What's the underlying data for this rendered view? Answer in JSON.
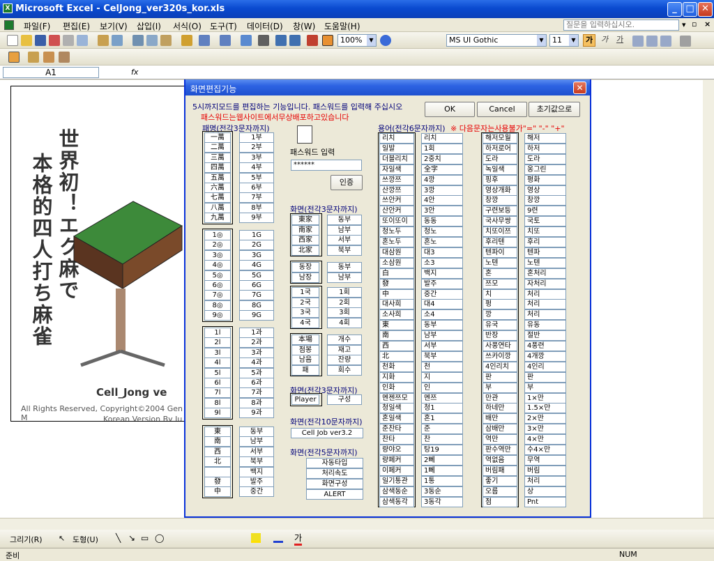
{
  "window": {
    "title": "Microsoft Excel - CelJong_ver320s_kor.xls",
    "minimize": "_",
    "maximize": "□",
    "close": "✕"
  },
  "menus": [
    "파일(F)",
    "편집(E)",
    "보기(V)",
    "삽입(I)",
    "서식(O)",
    "도구(T)",
    "데이터(D)",
    "창(W)",
    "도움말(H)"
  ],
  "help_placeholder": "질문을 입력하십시오.",
  "toolbar": {
    "zoom": "100%",
    "font": "MS UI Gothic",
    "size": "11",
    "bold": "가",
    "italic": "가",
    "underline": "가"
  },
  "formula": {
    "cell": "A1",
    "fx": "fx"
  },
  "splash": {
    "jp": [
      "世界初！エク麻で",
      "本格的四人打ち麻雀"
    ],
    "name": "Cell_Jong ve",
    "copyright": "All Rights Reserved, Copyright©2004 Gen M",
    "korean": "Korean Version By Ju"
  },
  "dialog": {
    "title": "화면편집기능",
    "desc1": "5시까지모드를 편집하는 기능입니다. 패스워드를 입력해 주십시오",
    "desc2": "패스워드는웹사이트에서무상배포하고있습니다",
    "ok": "OK",
    "cancel": "Cancel",
    "reset": "초기값으로",
    "pai_label": "패명(전각3문자까지)",
    "pai": [
      [
        [
          "一萬",
          "1부"
        ],
        [
          "二萬",
          "2부"
        ],
        [
          "三萬",
          "3부"
        ],
        [
          "四萬",
          "4부"
        ],
        [
          "五萬",
          "5부"
        ],
        [
          "六萬",
          "6부"
        ],
        [
          "七萬",
          "7부"
        ],
        [
          "八萬",
          "8부"
        ],
        [
          "九萬",
          "9부"
        ]
      ],
      [
        [
          "1◎",
          "1G"
        ],
        [
          "2◎",
          "2G"
        ],
        [
          "3◎",
          "3G"
        ],
        [
          "4◎",
          "4G"
        ],
        [
          "5◎",
          "5G"
        ],
        [
          "6◎",
          "6G"
        ],
        [
          "7◎",
          "7G"
        ],
        [
          "8◎",
          "8G"
        ],
        [
          "9◎",
          "9G"
        ]
      ],
      [
        [
          "1l",
          "1과"
        ],
        [
          "2l",
          "2과"
        ],
        [
          "3l",
          "3과"
        ],
        [
          "4l",
          "4과"
        ],
        [
          "5l",
          "5과"
        ],
        [
          "6l",
          "6과"
        ],
        [
          "7l",
          "7과"
        ],
        [
          "8l",
          "8과"
        ],
        [
          "9l",
          "9과"
        ]
      ],
      [
        [
          "東",
          "동부"
        ],
        [
          "南",
          "남부"
        ],
        [
          "西",
          "서부"
        ],
        [
          "北",
          "북부"
        ],
        [
          "",
          "백지"
        ],
        [
          "發",
          "발주"
        ],
        [
          "中",
          "중간"
        ]
      ]
    ],
    "pw_label": "패스워드 입력",
    "pw_value": "******",
    "auth": "인증",
    "screen_label": "화면(전각3문자까지)",
    "screen1": [
      [
        "東家",
        "동부"
      ],
      [
        "南家",
        "남부"
      ],
      [
        "西家",
        "서부"
      ],
      [
        "北家",
        "북부"
      ]
    ],
    "screen2": [
      [
        "동장",
        "동부"
      ],
      [
        "남장",
        "남부"
      ]
    ],
    "screen3": [
      [
        "1국",
        "1회"
      ],
      [
        "2국",
        "2회"
      ],
      [
        "3국",
        "3회"
      ],
      [
        "4국",
        "4회"
      ]
    ],
    "screen4": [
      [
        "本場",
        "개수"
      ],
      [
        "점봉",
        "재고"
      ],
      [
        "남음",
        "잔량"
      ],
      [
        "패",
        "회수"
      ]
    ],
    "screen5": [
      [
        "Player",
        "구성"
      ]
    ],
    "screen10_label": "화면(전각10문자까지)",
    "screen10_value": "Cell Job ver3.2",
    "screen5c_label": "화면(전각5문자까지)",
    "screen5c": [
      "자동타입",
      "처리속도",
      "화면구성",
      "ALERT"
    ],
    "yaku_label": "용어(전각6문자까지)",
    "yaku_warn": "※ 다음문자는사용불가\"=\" \"-\" \"+\"",
    "yaku1": [
      [
        "리치",
        "리치"
      ],
      [
        "일발",
        "1회"
      ],
      [
        "더블리치",
        "2중치"
      ],
      [
        "자일색",
        "全字"
      ],
      [
        "쓰깡쯔",
        "4깡"
      ],
      [
        "산깡쯔",
        "3깡"
      ],
      [
        "쓰안커",
        "4안"
      ],
      [
        "산안커",
        "3안"
      ],
      [
        "또이또이",
        "동동"
      ],
      [
        "청노두",
        "청노"
      ],
      [
        "혼노두",
        "혼노"
      ],
      [
        "대삼원",
        "대3"
      ],
      [
        "소삼원",
        "소3"
      ],
      [
        "白",
        "백지"
      ],
      [
        "發",
        "발주"
      ],
      [
        "中",
        "중간"
      ],
      [
        "대사희",
        "대4"
      ],
      [
        "소사희",
        "소4"
      ],
      [
        "東",
        "동부"
      ],
      [
        "南",
        "남부"
      ],
      [
        "西",
        "서부"
      ],
      [
        "北",
        "북부"
      ],
      [
        "천화",
        "천"
      ],
      [
        "지화",
        "지"
      ],
      [
        "인화",
        "인"
      ],
      [
        "멘젠쯔모",
        "멘쯔"
      ],
      [
        "청일색",
        "청1"
      ],
      [
        "혼일색",
        "혼1"
      ],
      [
        "준찬타",
        "준"
      ],
      [
        "찬타",
        "찬"
      ],
      [
        "량야오",
        "탕19"
      ],
      [
        "량페커",
        "2뻬"
      ],
      [
        "이페커",
        "1뻬"
      ],
      [
        "일기통관",
        "1통"
      ],
      [
        "삼색동순",
        "3동순"
      ],
      [
        "삼색동각",
        "3동각"
      ]
    ],
    "yaku2": [
      [
        "해저모월",
        "해저"
      ],
      [
        "하저로어",
        "하저"
      ],
      [
        "도라",
        "도라"
      ],
      [
        "녹일색",
        "옹그린"
      ],
      [
        "핑후",
        "평화"
      ],
      [
        "영상개화",
        "영상"
      ],
      [
        "창깡",
        "창깡"
      ],
      [
        "구련보등",
        "9련"
      ],
      [
        "국사무쌍",
        "국토"
      ],
      [
        "치또이쯔",
        "치또"
      ],
      [
        "후리텐",
        "후리"
      ],
      [
        "텐파이",
        "텐파"
      ],
      [
        "노텐",
        "노텐"
      ],
      [
        "혼",
        "혼처리"
      ],
      [
        "쯔모",
        "자처리"
      ],
      [
        "치",
        "처리"
      ],
      [
        "펑",
        "처리"
      ],
      [
        "깡",
        "처리"
      ],
      [
        "유국",
        "유동"
      ],
      [
        "반장",
        "절반"
      ],
      [
        "사풍연타",
        "4풍련"
      ],
      [
        "쓰카이깡",
        "4개깡"
      ],
      [
        "4인리치",
        "4인리"
      ],
      [
        "판",
        "판"
      ],
      [
        "부",
        "부"
      ],
      [
        "만관",
        "1×만"
      ],
      [
        "하네만",
        "1.5×만"
      ],
      [
        "배만",
        "2×만"
      ],
      [
        "삼배만",
        "3×만"
      ],
      [
        "역만",
        "4×만"
      ],
      [
        "판수역만",
        "수4×만"
      ],
      [
        "역없음",
        "무역"
      ],
      [
        "버림패",
        "버림"
      ],
      [
        "좋기",
        "처리"
      ],
      [
        "오름",
        "상"
      ],
      [
        "점",
        "Pnt"
      ]
    ]
  },
  "drawbar": {
    "draw": "그리기(R)",
    "shapes": "도형(U)"
  },
  "status": {
    "ready": "준비",
    "num": "NUM"
  }
}
